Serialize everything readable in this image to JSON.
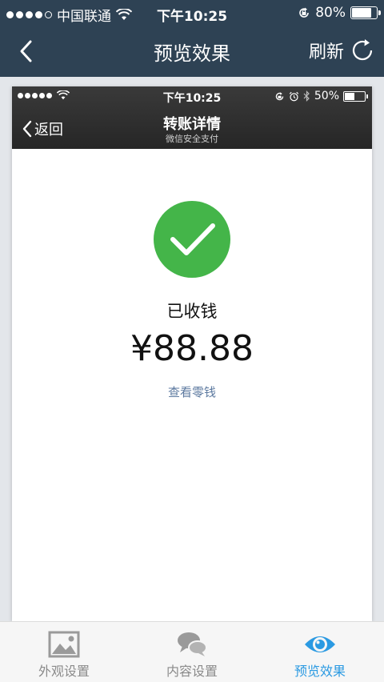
{
  "outer_status": {
    "carrier": "中国联通",
    "time": "下午10:25",
    "battery_percent": "80%",
    "battery_level": 0.8
  },
  "outer_nav": {
    "title": "预览效果",
    "refresh_label": "刷新"
  },
  "preview": {
    "status": {
      "time": "下午10:25",
      "battery_percent": "50%",
      "battery_level": 0.5
    },
    "nav": {
      "back_label": "返回",
      "title": "转账详情",
      "subtitle": "微信安全支付"
    },
    "received_label": "已收钱",
    "amount": "¥88.88",
    "change_link": "查看零钱"
  },
  "tabs": [
    {
      "label": "外观设置",
      "icon": "image-icon"
    },
    {
      "label": "内容设置",
      "icon": "chat-bubbles-icon"
    },
    {
      "label": "预览效果",
      "icon": "eye-icon",
      "active": true
    }
  ],
  "colors": {
    "header_bg": "#2e4254",
    "success_green": "#44b549",
    "active_tab": "#2b9ae2",
    "link_blue": "#5d7aa0"
  }
}
